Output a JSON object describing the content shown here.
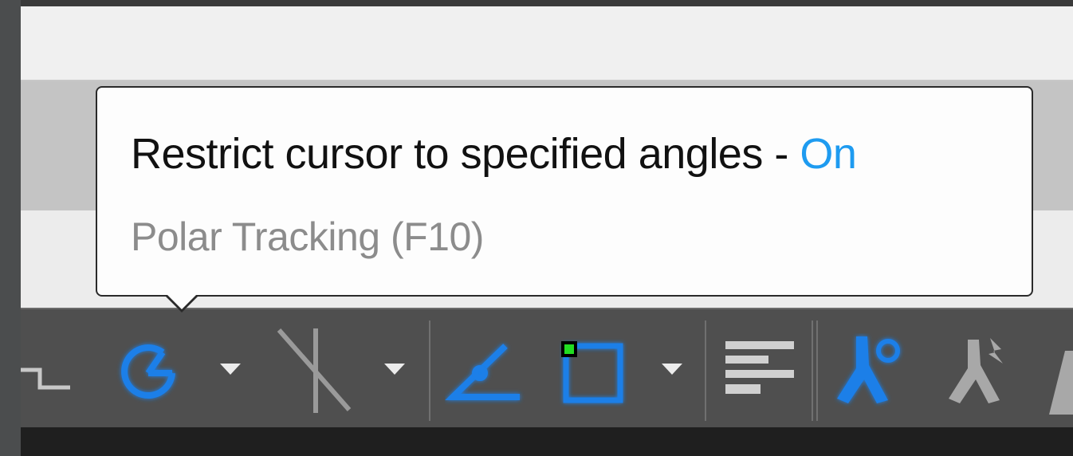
{
  "tooltip": {
    "description": "Restrict cursor to specified angles - ",
    "state": "On",
    "command": "Polar Tracking (F10)"
  },
  "statusbar": {
    "icons": [
      "ortho-mode-icon",
      "polar-tracking-icon",
      "polar-tracking-dropdown-icon",
      "isometric-drafting-icon",
      "isometric-drafting-dropdown-icon",
      "object-snap-tracking-icon",
      "object-snap-icon",
      "object-snap-dropdown-icon",
      "lineweight-icon",
      "annotation-visibility-icon",
      "auto-scale-icon",
      "annotation-scale-icon"
    ]
  },
  "colors": {
    "accent": "#1e9bf0",
    "icon_blue": "#1a7fe8",
    "icon_grey": "#b8b8b8",
    "status_bar": "#4f4f4f",
    "snap_marker": "#22dd22"
  }
}
